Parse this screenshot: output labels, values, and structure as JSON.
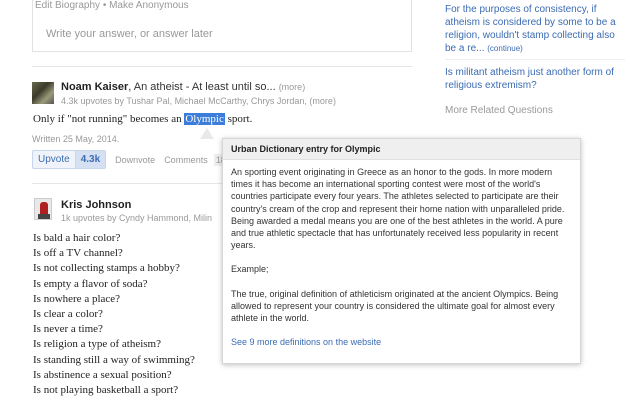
{
  "top_answer": {
    "links": "Edit Biography • Make Anonymous",
    "answer_placeholder": "Write your answer, or answer later"
  },
  "answer1": {
    "author": "Noam Kaiser",
    "tagline": ", An atheist - At least until so...",
    "more": "(more)",
    "upvote_line": "4.3k upvotes by Tushar Pal, Michael McCarthy, Chrys Jordan, (more)",
    "text_before": "Only if \"not running\" becomes an ",
    "highlight": "Olympic",
    "text_after": " sport.",
    "written": "Written 25 May, 2014.",
    "upvote_label": "Upvote",
    "upvote_count": "4.3k",
    "downvote_label": "Downvote",
    "comments_label": "Comments",
    "comments_count": "18+"
  },
  "answer2": {
    "author": "Kris Johnson",
    "upvote_line": "1k upvotes by Cyndy Hammond, Milin",
    "questions": [
      "Is bald a hair color?",
      "Is off a TV channel?",
      "Is not collecting stamps a hobby?",
      "Is empty a flavor of soda?",
      "Is nowhere a place?",
      "Is clear a color?",
      "Is never a time?",
      "Is religion a type of atheism?",
      "Is standing still a way of swimming?",
      "Is abstinence a sexual position?",
      "Is not playing basketball a sport?"
    ]
  },
  "sidebar": {
    "item1_text": "For the purposes of consistency, if atheism is considered by some to be a religion, wouldn't stamp collecting also be a re...",
    "item1_continue": "(continue)",
    "item2_text": "Is militant atheism just another form of religious extremism?",
    "more_related": "More Related Questions"
  },
  "popup": {
    "title": "Urban Dictionary entry for Olympic",
    "paragraph1": "An sporting event originating in Greece as an honor to the gods. In more modern times it has become an international sporting contest were most of the world's countries participate every four years. The athletes selected to participate are their country's cream of the crop and represent their home nation with unparalleled pride. Being awarded a medal means you are one of the best athletes in the world. A pure and true athletic spectacle that has unfortunately received less popularity in recent years.",
    "paragraph2": "Example;",
    "paragraph3": "The true, original definition of athleticism originated at the ancient Olympics. Being allowed to represent your country is considered the ultimate goal for almost every athlete in the world.",
    "more_link": "See 9 more definitions on the website"
  }
}
